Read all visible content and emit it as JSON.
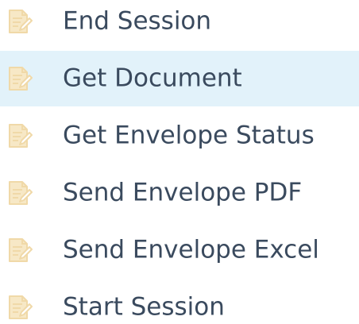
{
  "menu": {
    "items": [
      {
        "label": "End Session",
        "icon": "document-edit-icon"
      },
      {
        "label": "Get Document",
        "icon": "document-edit-icon",
        "highlighted": true
      },
      {
        "label": "Get Envelope Status",
        "icon": "document-edit-icon"
      },
      {
        "label": "Send Envelope PDF",
        "icon": "document-edit-icon"
      },
      {
        "label": "Send Envelope Excel",
        "icon": "document-edit-icon"
      },
      {
        "label": "Start Session",
        "icon": "document-edit-icon"
      }
    ]
  },
  "colors": {
    "icon": "#f0d9a8",
    "text": "#3a4a5e",
    "highlight": "#e2f2fa"
  }
}
